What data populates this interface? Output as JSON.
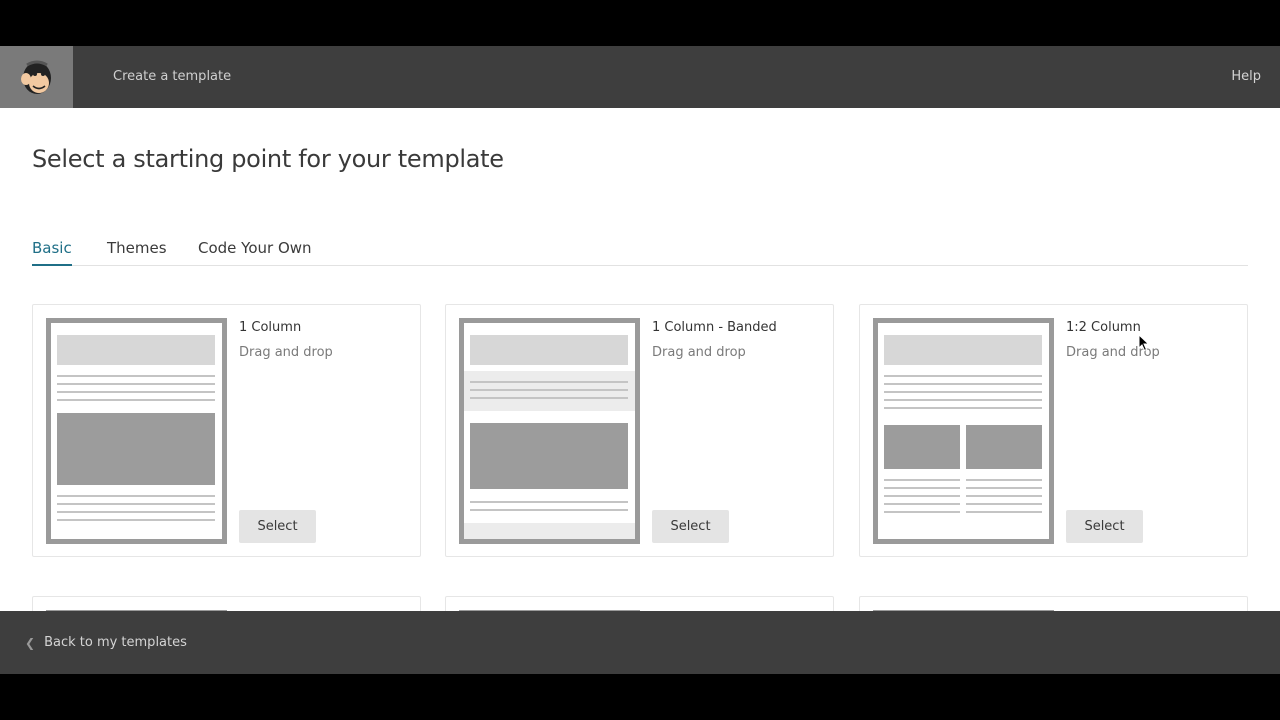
{
  "header": {
    "app_title": "Create a template",
    "help_label": "Help",
    "logo_icon": "monkey-logo-icon"
  },
  "page": {
    "title": "Select a starting point for your template"
  },
  "tabs": [
    {
      "label": "Basic",
      "active": true
    },
    {
      "label": "Themes",
      "active": false
    },
    {
      "label": "Code Your Own",
      "active": false
    }
  ],
  "templates": [
    {
      "title": "1 Column",
      "subtitle": "Drag and drop",
      "button": "Select"
    },
    {
      "title": "1 Column - Banded",
      "subtitle": "Drag and drop",
      "button": "Select"
    },
    {
      "title": "1:2 Column",
      "subtitle": "Drag and drop",
      "button": "Select"
    }
  ],
  "footer": {
    "back_label": "Back to my templates",
    "back_icon": "chevron-left-icon"
  },
  "colors": {
    "header_bg": "#3e3e3e",
    "active_tab": "#1f6f87",
    "thumb_border": "#9a9a9a"
  }
}
